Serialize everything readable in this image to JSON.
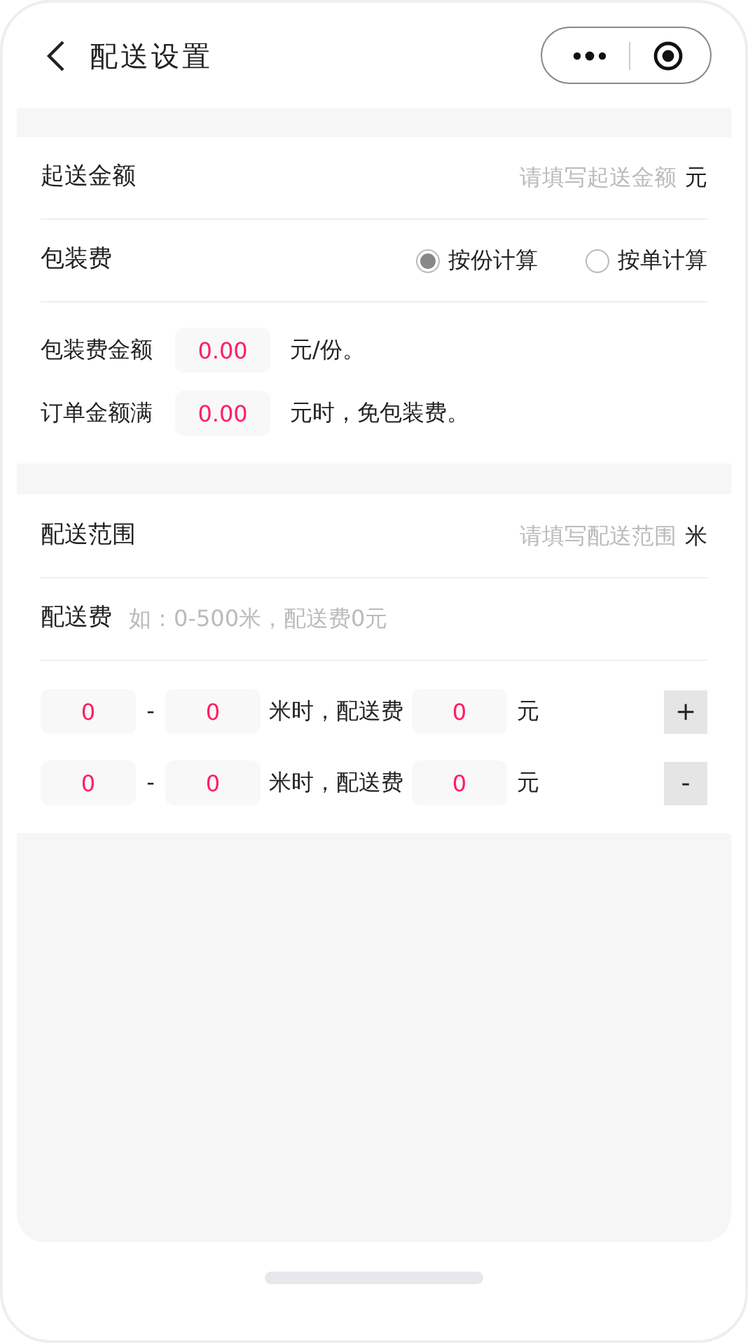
{
  "header": {
    "title": "配送设置"
  },
  "min_order": {
    "label": "起送金额",
    "placeholder": "请填写起送金额",
    "unit": "元"
  },
  "packing_fee": {
    "label": "包装费",
    "options": [
      {
        "label": "按份计算",
        "selected": true
      },
      {
        "label": "按单计算",
        "selected": false
      }
    ]
  },
  "packing_rows": [
    {
      "label": "包装费金额",
      "value": "0.00",
      "suffix": "元/份。"
    },
    {
      "label": "订单金额满",
      "value": "0.00",
      "suffix": "元时，免包装费。"
    }
  ],
  "range": {
    "label": "配送范围",
    "placeholder": "请填写配送范围",
    "unit": "米"
  },
  "delivery_fee": {
    "label": "配送费",
    "placeholder": "如：0-500米，配送费0元"
  },
  "tiers": [
    {
      "from": "0",
      "dash": "-",
      "to": "0",
      "middle": "米时，配送费",
      "fee": "0",
      "unit": "元",
      "action": "+"
    },
    {
      "from": "0",
      "dash": "-",
      "to": "0",
      "middle": "米时，配送费",
      "fee": "0",
      "unit": "元",
      "action": "-"
    }
  ]
}
